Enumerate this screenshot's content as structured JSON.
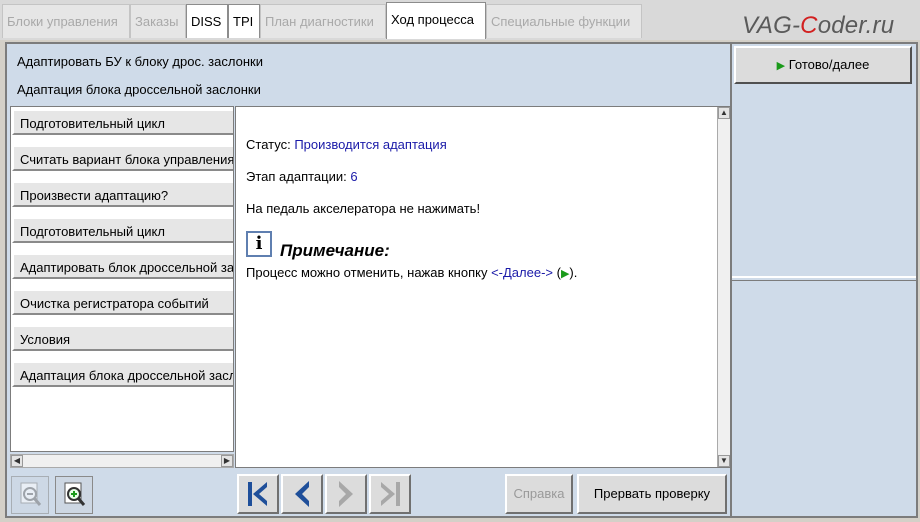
{
  "tabs": [
    {
      "label": "Блоки управления"
    },
    {
      "label": "Заказы"
    },
    {
      "label": "DISS"
    },
    {
      "label": "TPI"
    },
    {
      "label": "План диагностики"
    },
    {
      "label": "Ход процесса"
    },
    {
      "label": "Специальные функции"
    }
  ],
  "watermark": {
    "part1": "VAG-",
    "part2": "C",
    "part3": "oder.ru"
  },
  "header": {
    "line1": "Адаптировать БУ к блоку дрос. заслонки",
    "line2": "Адаптация блока дроссельной заслонки"
  },
  "steps": [
    "Подготовительный цикл",
    "Считать вариант блока управления",
    "Произвести адаптацию?",
    "Подготовительный цикл",
    "Адаптировать блок дроссельной заслонки",
    "Очистка регистратора событий",
    "Условия",
    "Адаптация блока дроссельной заслонки"
  ],
  "content": {
    "status_label": "Статус: ",
    "status_value": "Производится адаптация",
    "stage_label": "Этап адаптации: ",
    "stage_value": "6",
    "warning": "На педаль акселератора не нажимать!",
    "note_title": "Примечание:",
    "note_text_pre": "Процесс можно отменить, нажав кнопку ",
    "note_link": "<-Далее->",
    "note_open": " (",
    "note_close": ")."
  },
  "buttons": {
    "help": "Справка",
    "abort": "Прервать проверку",
    "done": "Готово/далее"
  },
  "colors": {
    "accent_blue": "#1a1aa8",
    "play_green": "#1a9a1a",
    "panel_bg": "#cfdbe9"
  }
}
